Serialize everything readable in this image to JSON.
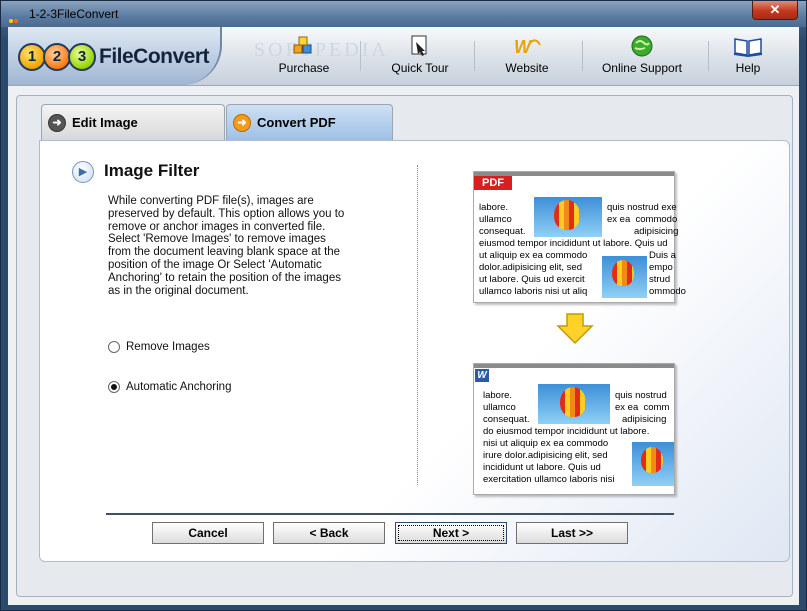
{
  "window": {
    "title": "1-2-3FileConvert",
    "close_label": "✕"
  },
  "header": {
    "logo": {
      "n1": "1",
      "n2": "2",
      "n3": "3",
      "name": "FileConvert"
    },
    "watermark": "SOFTPEDIA",
    "buttons": [
      {
        "label": "Purchase",
        "icon": "purchase-icon"
      },
      {
        "label": "Quick Tour",
        "icon": "quick-tour-icon"
      },
      {
        "label": "Website",
        "icon": "website-icon"
      },
      {
        "label": "Online Support",
        "icon": "online-support-icon"
      },
      {
        "label": "Help",
        "icon": "help-book-icon"
      }
    ]
  },
  "tabs": [
    {
      "label": "Edit Image",
      "active": false
    },
    {
      "label": "Convert PDF",
      "active": true
    }
  ],
  "section": {
    "title": "Image Filter",
    "description": "While converting PDF file(s), images are preserved by default. This option allows you to remove or anchor images in converted file. Select 'Remove Images' to remove images from the document leaving blank space at the position of the image Or Select 'Automatic Anchoring' to retain the position of the images as in the original document.",
    "options": [
      {
        "label": "Remove Images",
        "checked": false
      },
      {
        "label": "Automatic Anchoring",
        "checked": true
      }
    ]
  },
  "preview": {
    "pdf_tag": "PDF",
    "word_tag": "W",
    "pdf_lines": [
      "labore.",
      "ullamco",
      "consequat.",
      "eiusmod tempor incididunt ut labore. Quis ud",
      "ut aliquip ex ea commodo",
      "dolor.adipisicing elit, sed",
      "ut labore. Quis ud exercit",
      "ullamco laboris nisi ut aliq"
    ],
    "pdf_right_lines": [
      "quis nostrud exe",
      "ex ea  commodo",
      "adipisicing"
    ],
    "pdf_right_lower": [
      "Duis a",
      "empo",
      "strud",
      "ommodo"
    ],
    "word_lines": [
      "labore.",
      "ullamco",
      "consequat.",
      "do eiusmod tempor incididunt ut labore.",
      "nisi ut aliquip ex ea commodo",
      "irure dolor.adipisicing elit, sed",
      "incididunt ut labore. Quis ud",
      "exercitation ullamco laboris nisi"
    ],
    "word_right_lines": [
      "quis nostrud",
      "ex ea  comm",
      "adipisicing"
    ]
  },
  "nav": {
    "cancel": "Cancel",
    "back": "< Back",
    "next": "Next >",
    "last": "Last >>"
  }
}
